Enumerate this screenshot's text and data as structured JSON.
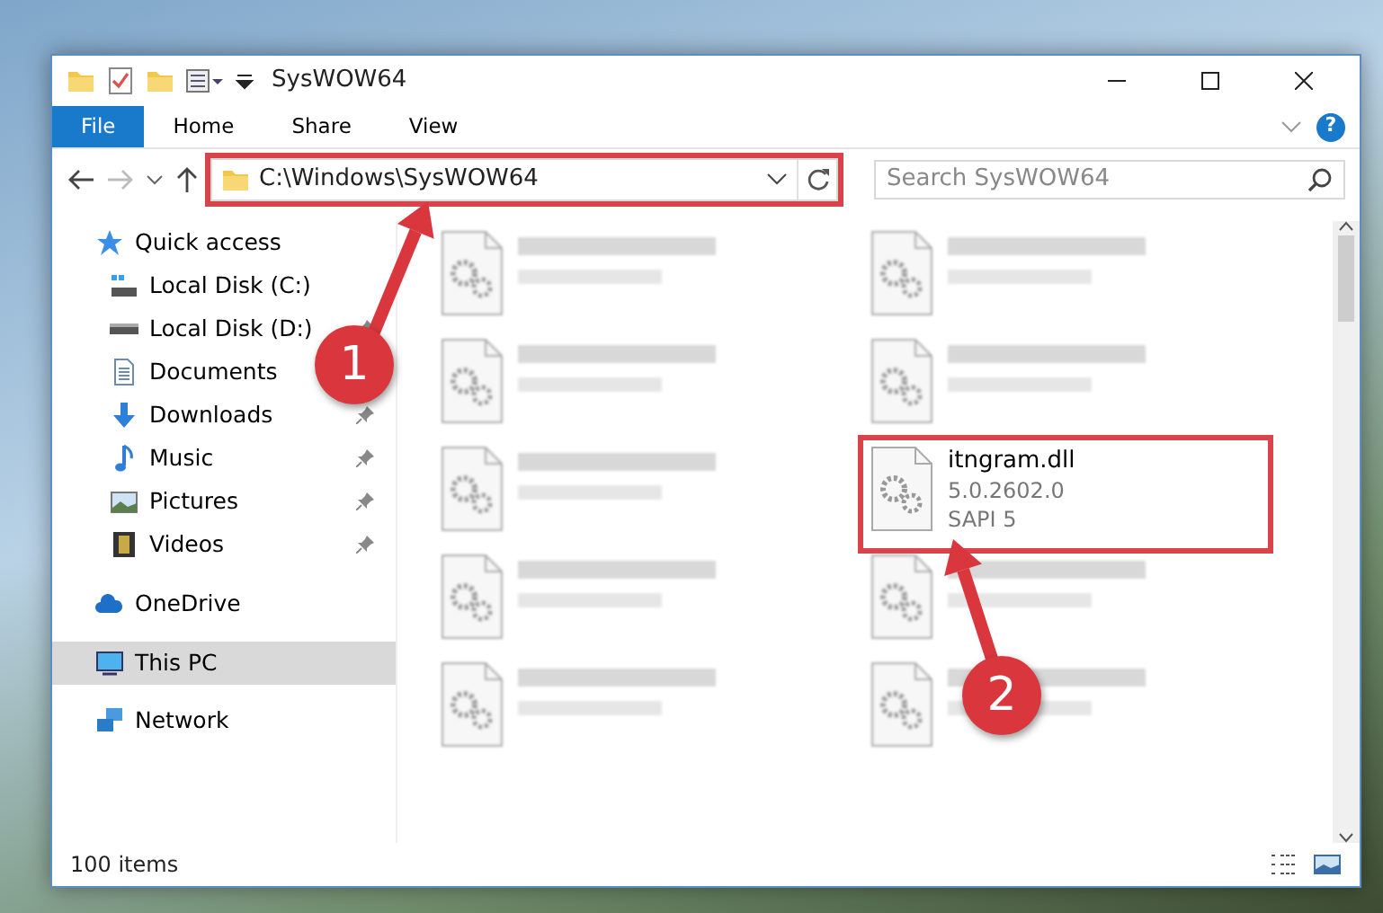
{
  "window": {
    "title": "SysWOW64",
    "help": "?"
  },
  "ribbon_tabs": [
    {
      "label": "File",
      "kind": "file"
    },
    {
      "label": "Home",
      "kind": "tab"
    },
    {
      "label": "Share",
      "kind": "tab"
    },
    {
      "label": "View",
      "kind": "tab"
    }
  ],
  "address": {
    "path": "C:\\Windows\\SysWOW64",
    "annotated": true
  },
  "search": {
    "placeholder": "Search SysWOW64"
  },
  "nav_items": [
    {
      "label": "Quick access",
      "kind": "star",
      "selected": false,
      "children": [
        {
          "label": "Local Disk (C:)",
          "kind": "drive-c",
          "pinned": false,
          "selected": false
        },
        {
          "label": "Local Disk (D:)",
          "kind": "drive",
          "pinned": true,
          "selected": false
        },
        {
          "label": "Documents",
          "kind": "documents",
          "selected": false
        },
        {
          "label": "Downloads",
          "kind": "downloads",
          "pinned": true,
          "selected": false
        },
        {
          "label": "Music",
          "kind": "music",
          "pinned": true,
          "selected": false
        },
        {
          "label": "Pictures",
          "kind": "pictures",
          "pinned": true,
          "selected": false
        },
        {
          "label": "Videos",
          "kind": "videos",
          "pinned": true,
          "selected": false
        }
      ]
    },
    {
      "label": "OneDrive",
      "kind": "cloud",
      "selected": false
    },
    {
      "label": "This PC",
      "kind": "pc",
      "selected": true
    },
    {
      "label": "Network",
      "kind": "network",
      "selected": false
    }
  ],
  "files": [
    {
      "blurred": true,
      "annotated": false
    },
    {
      "blurred": true,
      "annotated": false
    },
    {
      "blurred": true,
      "annotated": false
    },
    {
      "blurred": true,
      "annotated": false
    },
    {
      "blurred": true,
      "annotated": false
    },
    {
      "name": "itngram.dll",
      "details": [
        "5.0.2602.0",
        "SAPI 5"
      ],
      "blurred": false,
      "annotated": true
    },
    {
      "blurred": true,
      "annotated": false
    },
    {
      "blurred": true,
      "annotated": false
    },
    {
      "blurred": true,
      "annotated": false
    },
    {
      "blurred": true,
      "annotated": false
    }
  ],
  "status_bar": {
    "count": "100 items"
  },
  "annotations": [
    {
      "label": "1"
    },
    {
      "label": "2"
    }
  ]
}
